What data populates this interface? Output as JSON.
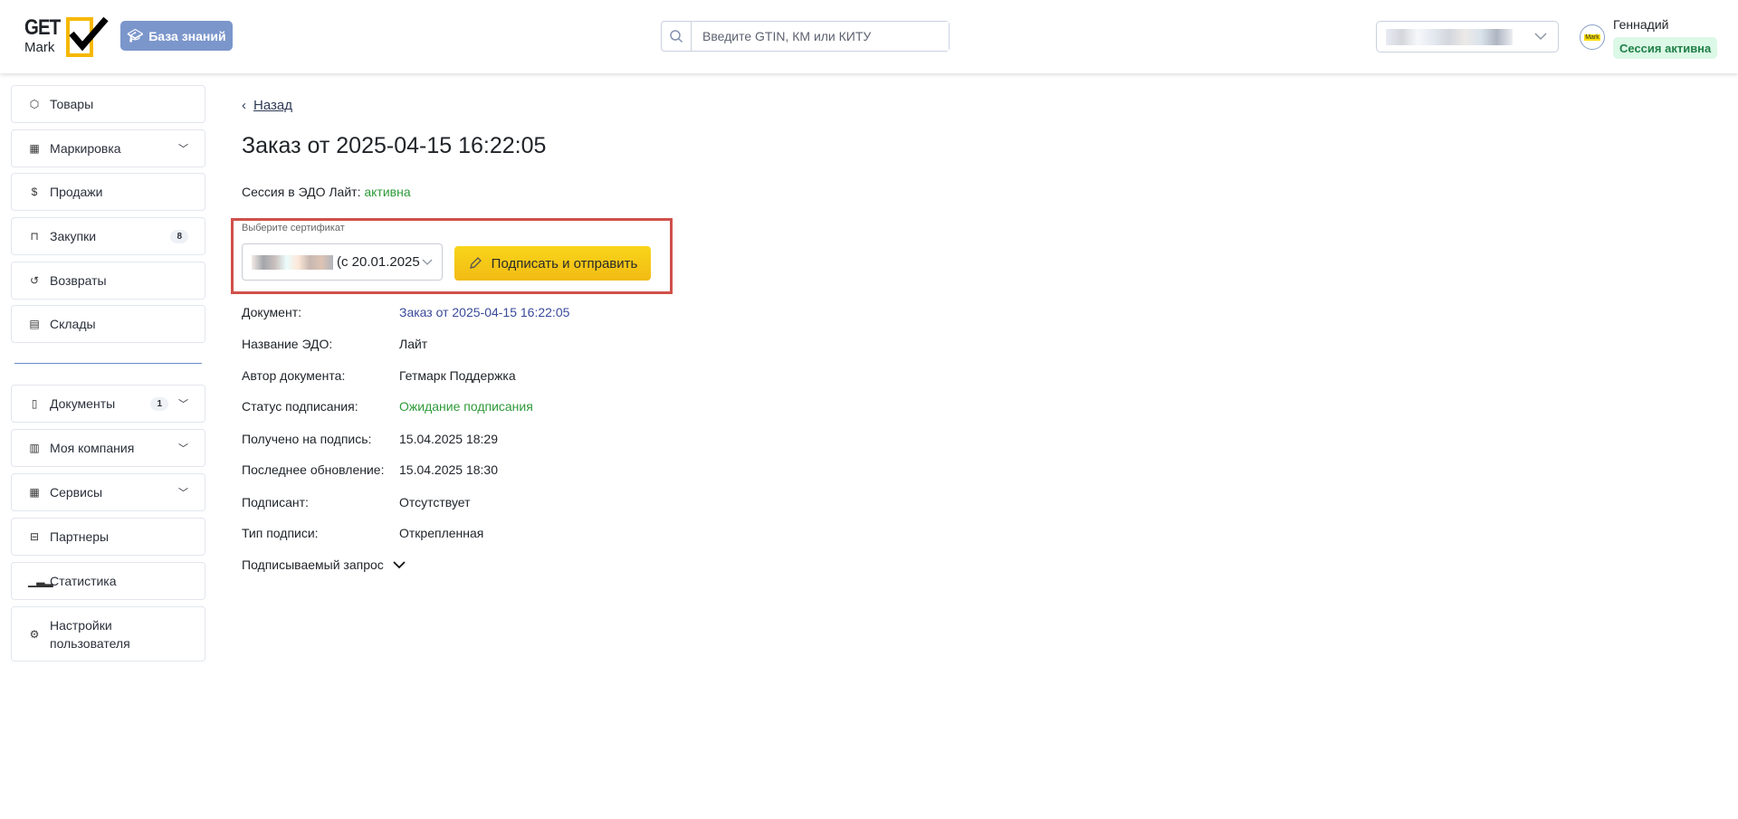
{
  "header": {
    "logo_text": "GET Mark",
    "kb_button": "База знаний",
    "search_placeholder": "Введите GTIN, КМ или КИТУ",
    "user_name": "Геннадий",
    "session_badge": "Сессия активна",
    "avatar_text": "Mark"
  },
  "sidebar": {
    "group1": [
      {
        "label": "Товары",
        "icon": "box-icon"
      },
      {
        "label": "Маркировка",
        "icon": "qr-icon",
        "dropdown": true
      },
      {
        "label": "Продажи",
        "icon": "dollar-icon"
      },
      {
        "label": "Закупки",
        "icon": "bag-icon",
        "badge": "8"
      },
      {
        "label": "Возвраты",
        "icon": "return-icon"
      },
      {
        "label": "Склады",
        "icon": "warehouse-icon"
      }
    ],
    "group2": [
      {
        "label": "Документы",
        "icon": "document-icon",
        "badge": "1",
        "dropdown": true
      },
      {
        "label": "Моя компания",
        "icon": "building-icon",
        "dropdown": true
      },
      {
        "label": "Сервисы",
        "icon": "grid-icon",
        "dropdown": true
      },
      {
        "label": "Партнеры",
        "icon": "briefcase-icon"
      },
      {
        "label": "Статистика",
        "icon": "chart-icon"
      },
      {
        "label": "Настройки пользователя",
        "icon": "gear-icon"
      }
    ]
  },
  "main": {
    "back": "Назад",
    "title": "Заказ от 2025-04-15 16:22:05",
    "session_label": "Сессия в ЭДО Лайт:",
    "session_value": "активна",
    "cert_label": "Выберите сертификат",
    "cert_value": "(с 20.01.2025",
    "sign_button": "Подписать и отправить",
    "details": [
      {
        "k": "Документ:",
        "v": "Заказ от 2025-04-15 16:22:05"
      },
      {
        "k": "Название ЭДО:",
        "v": "Лайт"
      },
      {
        "k": "Автор документа:",
        "v": "Гетмарк Поддержка"
      },
      {
        "k": "Статус подписания:",
        "v": "Ожидание подписания"
      },
      {
        "k": "Получено на подпись:",
        "v": "15.04.2025 18:29"
      },
      {
        "k": "Последнее обновление:",
        "v": "15.04.2025 18:30"
      },
      {
        "k": "Подписант:",
        "v": "Отсутствует"
      },
      {
        "k": "Тип подписи:",
        "v": "Открепленная"
      }
    ],
    "request_toggle": "Подписываемый запрос"
  },
  "colors": {
    "accent": "#f2bb14",
    "kb": "#7b96cb",
    "green": "#2f9a3a",
    "link": "#3a4a9a",
    "highlight": "#d0504a"
  }
}
